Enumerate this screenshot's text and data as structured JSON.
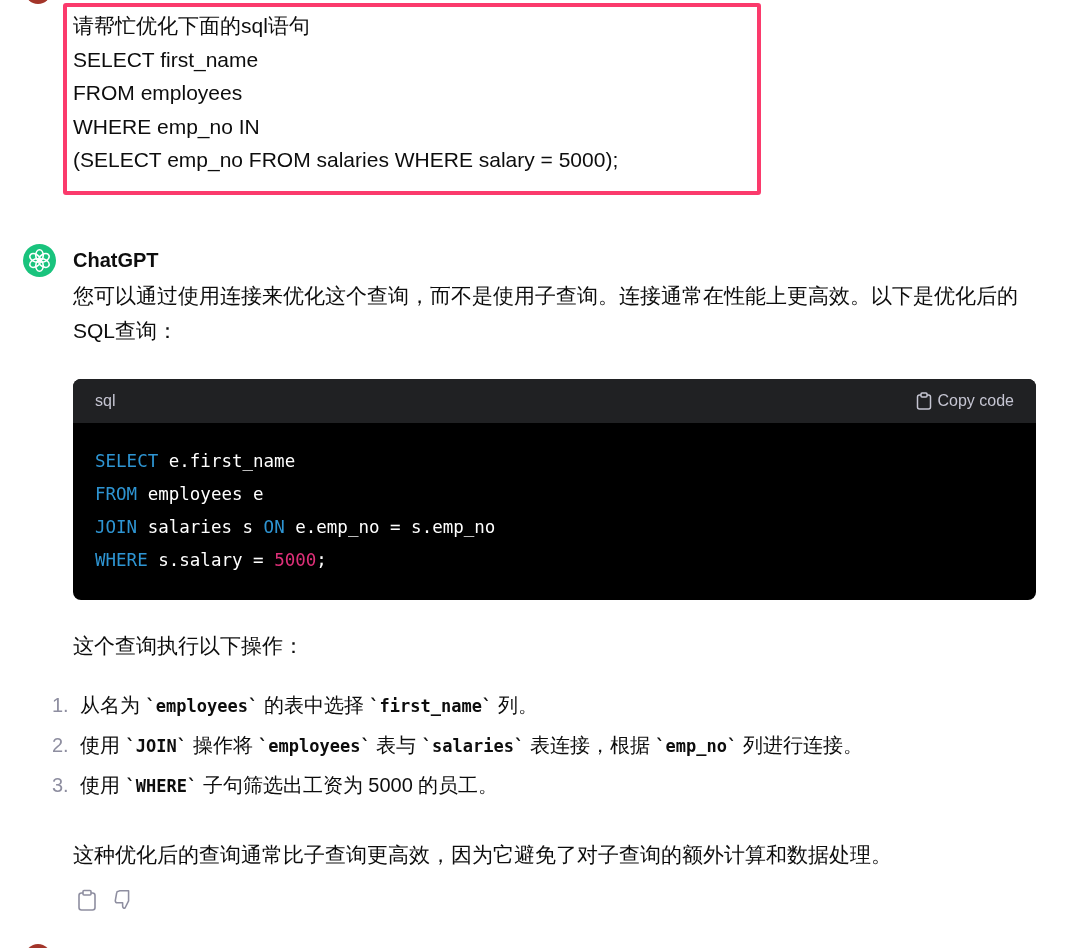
{
  "user_message": {
    "highlighted": true,
    "lines": [
      "请帮忙优化下面的sql语句",
      "SELECT first_name",
      "FROM employees",
      "WHERE emp_no IN",
      "(SELECT emp_no FROM salaries WHERE salary = 5000);"
    ]
  },
  "assistant": {
    "name": "ChatGPT",
    "intro": "您可以通过使用连接来优化这个查询，而不是使用子查询。连接通常在性能上更高效。以下是优化后的SQL查询：",
    "code_block": {
      "language": "sql",
      "copy_label": "Copy code",
      "lines": [
        [
          {
            "kind": "keyword",
            "text": "SELECT"
          },
          {
            "kind": "plain",
            "text": " e.first_name"
          }
        ],
        [
          {
            "kind": "keyword",
            "text": "FROM"
          },
          {
            "kind": "plain",
            "text": " employees e"
          }
        ],
        [
          {
            "kind": "keyword",
            "text": "JOIN"
          },
          {
            "kind": "plain",
            "text": " salaries s "
          },
          {
            "kind": "keyword",
            "text": "ON"
          },
          {
            "kind": "plain",
            "text": " e.emp_no = s.emp_no"
          }
        ],
        [
          {
            "kind": "keyword",
            "text": "WHERE"
          },
          {
            "kind": "plain",
            "text": " s.salary = "
          },
          {
            "kind": "number",
            "text": "5000"
          },
          {
            "kind": "plain",
            "text": ";"
          }
        ]
      ]
    },
    "steps_intro": "这个查询执行以下操作：",
    "steps": [
      {
        "number": "1.",
        "parts": [
          {
            "kind": "text",
            "text": "从名为 "
          },
          {
            "kind": "code",
            "text": "`employees`"
          },
          {
            "kind": "text",
            "text": " 的表中选择 "
          },
          {
            "kind": "code",
            "text": "`first_name`"
          },
          {
            "kind": "text",
            "text": " 列。"
          }
        ]
      },
      {
        "number": "2.",
        "parts": [
          {
            "kind": "text",
            "text": "使用 "
          },
          {
            "kind": "code",
            "text": "`JOIN`"
          },
          {
            "kind": "text",
            "text": " 操作将 "
          },
          {
            "kind": "code",
            "text": "`employees`"
          },
          {
            "kind": "text",
            "text": " 表与 "
          },
          {
            "kind": "code",
            "text": "`salaries`"
          },
          {
            "kind": "text",
            "text": " 表连接，根据 "
          },
          {
            "kind": "code",
            "text": "`emp_no`"
          },
          {
            "kind": "text",
            "text": " 列进行连接。"
          }
        ]
      },
      {
        "number": "3.",
        "parts": [
          {
            "kind": "text",
            "text": "使用 "
          },
          {
            "kind": "code",
            "text": "`WHERE`"
          },
          {
            "kind": "text",
            "text": " 子句筛选出工资为 5000 的员工。"
          }
        ]
      }
    ],
    "summary": "这种优化后的查询通常比子查询更高效，因为它避免了对子查询的额外计算和数据处理。"
  }
}
